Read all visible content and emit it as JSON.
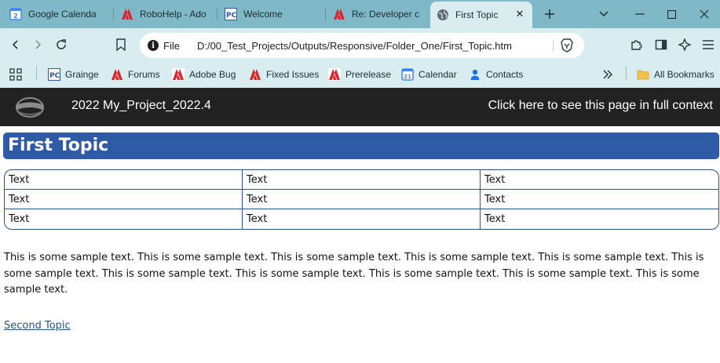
{
  "browser": {
    "tabs": [
      {
        "label": "Google Calenda",
        "icon": "google-calendar-icon",
        "active": false
      },
      {
        "label": "RoboHelp - Ado",
        "icon": "adobe-icon",
        "active": false
      },
      {
        "label": "Welcome",
        "icon": "pc-icon",
        "active": false
      },
      {
        "label": "Re: Developer ca",
        "icon": "adobe-icon",
        "active": false
      },
      {
        "label": "First Topic",
        "icon": "globe-icon",
        "active": true
      }
    ],
    "omnibox": {
      "scheme": "File",
      "url": "D:/00_Test_Projects/Outputs/Responsive/Folder_One/First_Topic.htm"
    },
    "bookmarks": [
      {
        "label": "Grainge",
        "icon": "pc-icon"
      },
      {
        "label": "Forums",
        "icon": "adobe-icon"
      },
      {
        "label": "Adobe Bug",
        "icon": "adobe-icon"
      },
      {
        "label": "Fixed Issues",
        "icon": "adobe-icon"
      },
      {
        "label": "Prerelease",
        "icon": "adobe-icon"
      },
      {
        "label": "Calendar",
        "icon": "google-calendar-icon"
      },
      {
        "label": "Contacts",
        "icon": "contacts-icon"
      }
    ],
    "all_bookmarks_label": "All Bookmarks",
    "colors": {
      "tabstrip": "#7fb8c6",
      "toolbar": "#d9ecf0",
      "active_tab": "#d9ecf0"
    }
  },
  "page": {
    "header": {
      "title": "2022 My_Project_2022.4",
      "full_context_link": "Click here to see this page in full context"
    },
    "topic_title": "First Topic",
    "table": {
      "rows": [
        [
          "Text",
          "Text",
          "Text"
        ],
        [
          "Text",
          "Text",
          "Text"
        ],
        [
          "Text",
          "Text",
          "Text"
        ]
      ]
    },
    "body_text": "This is some sample text. This is some sample text. This is some sample text. This is some sample text. This is some sample text. This is some sample text. This is some sample text. This is some sample text. This is some sample text. This is some sample text. This is some sample text.",
    "second_topic_link": "Second Topic",
    "colors": {
      "header_bg": "#222222",
      "heading_bg": "#2e5aa6",
      "table_border": "#2a5283",
      "link": "#2a5283"
    }
  }
}
